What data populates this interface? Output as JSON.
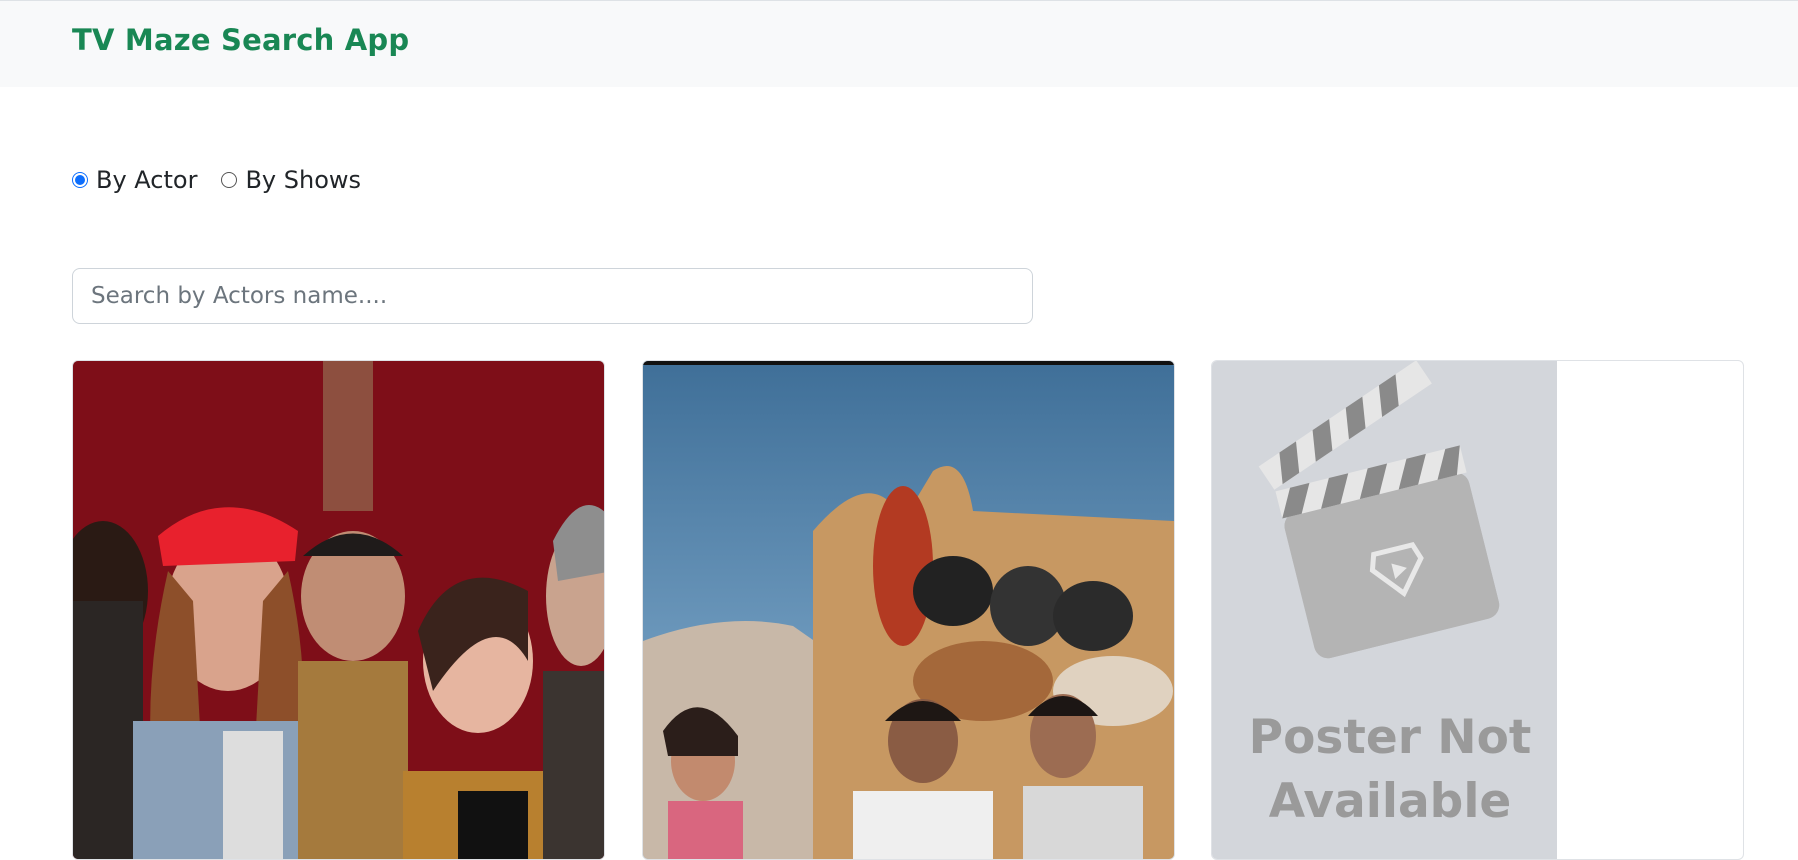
{
  "navbar": {
    "brand": "TV Maze Search App"
  },
  "search_mode": {
    "options": [
      {
        "label": "By Actor",
        "selected": true
      },
      {
        "label": "By Shows",
        "selected": false
      }
    ]
  },
  "search": {
    "placeholder": "Search by Actors name....",
    "value": ""
  },
  "results": [
    {
      "image": "group-photo-band-red-curtain"
    },
    {
      "image": "group-photo-graffiti-wall"
    },
    {
      "image": "poster-not-available",
      "placeholder_text": "Poster Not Available"
    }
  ],
  "colors": {
    "brand": "#198754",
    "accent": "#0d6efd",
    "navbar_bg": "#f8f9fa"
  }
}
